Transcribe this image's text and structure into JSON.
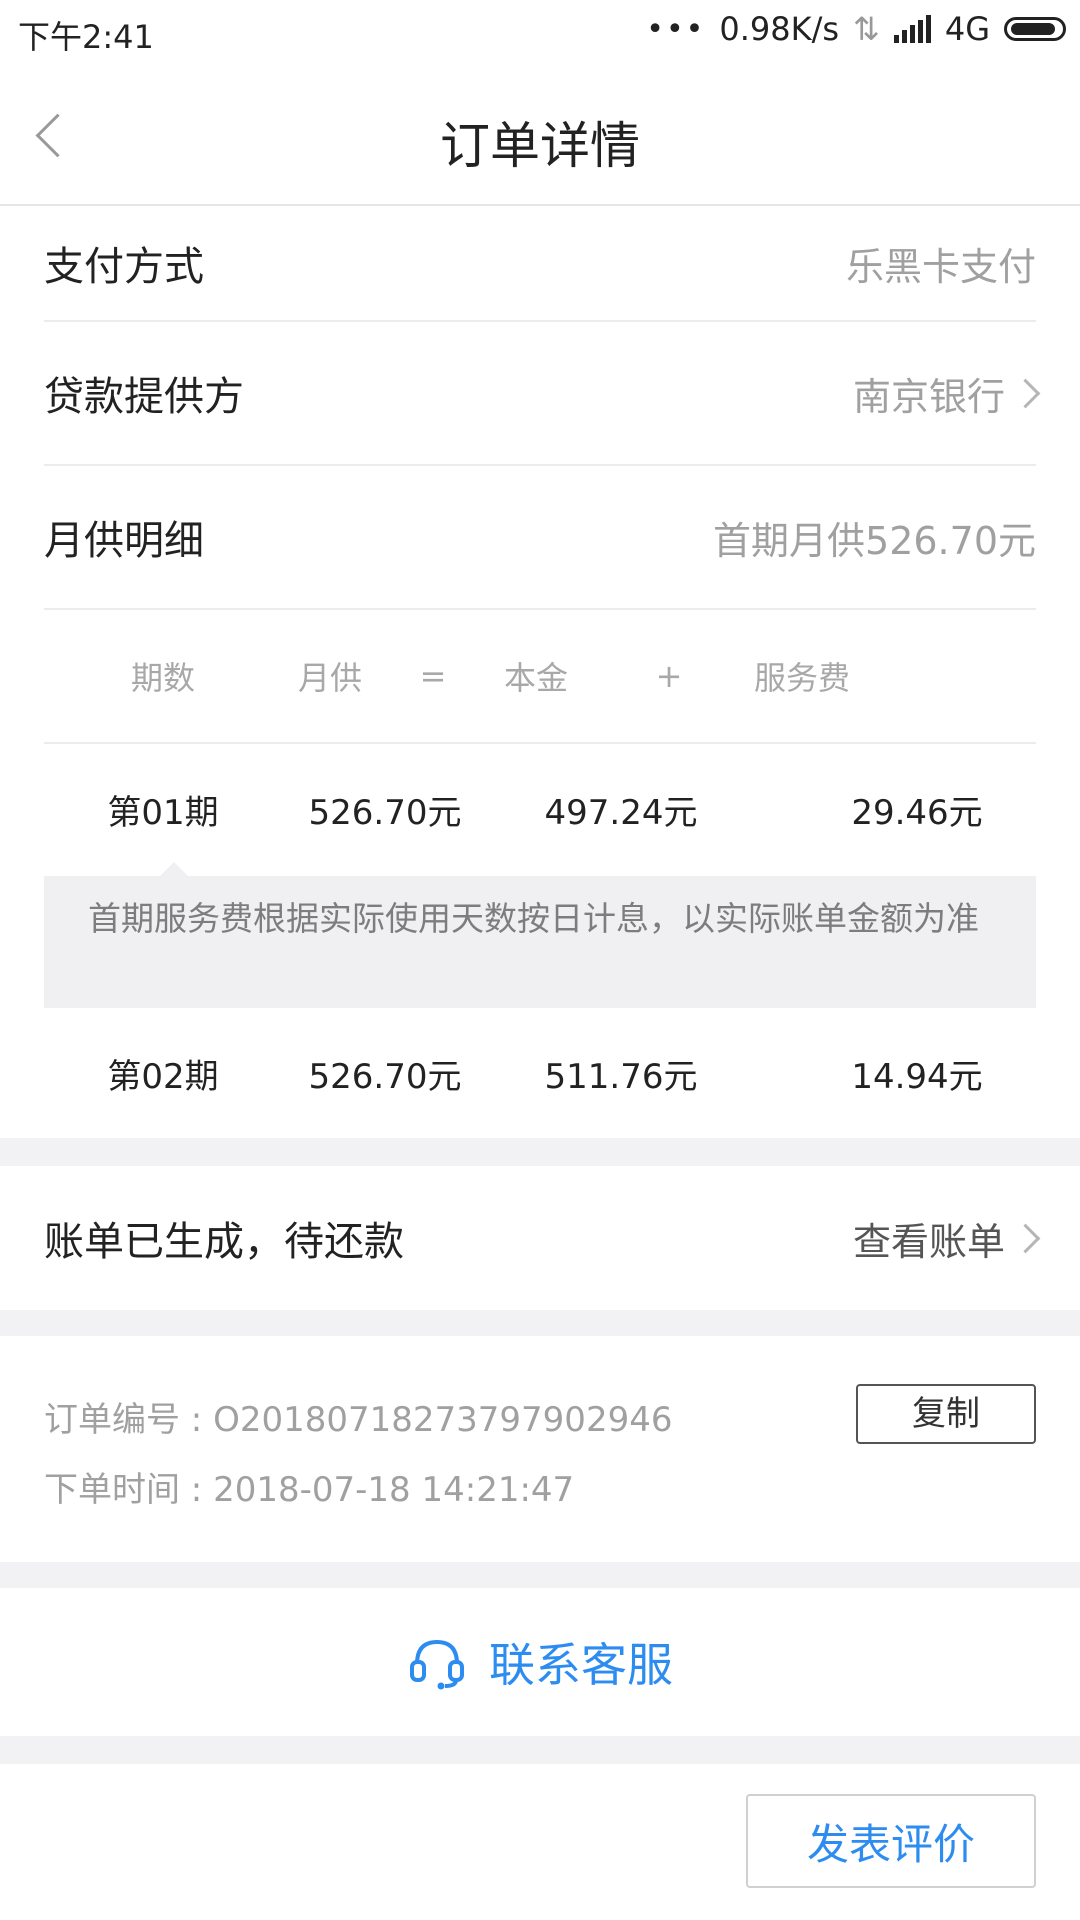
{
  "status_bar": {
    "time": "下午2:41",
    "speed": "0.98K/s",
    "network": "4G"
  },
  "header": {
    "title": "订单详情"
  },
  "payment": {
    "method_label": "支付方式",
    "method_value": "乐黑卡支付",
    "lender_label": "贷款提供方",
    "lender_value": "南京银行",
    "detail_label": "月供明细",
    "detail_value": "首期月供526.70元"
  },
  "table": {
    "headers": [
      "期数",
      "月供",
      "=",
      "本金",
      "+",
      "服务费"
    ],
    "rows": [
      {
        "period": "第01期",
        "monthly": "526.70元",
        "principal": "497.24元",
        "fee": "29.46元"
      },
      {
        "period": "第02期",
        "monthly": "526.70元",
        "principal": "511.76元",
        "fee": "14.94元"
      }
    ],
    "tip": "首期服务费根据实际使用天数按日计息，以实际账单金额为准"
  },
  "bill": {
    "status": "账单已生成，待还款",
    "link": "查看账单"
  },
  "order": {
    "number": "订单编号 : O20180718273797902946",
    "time": "下单时间 : 2018-07-18 14:21:47",
    "copy_label": "复制"
  },
  "service": {
    "label": "联系客服"
  },
  "footer": {
    "review_label": "发表评价"
  },
  "colors": {
    "accent": "#2c8cf0",
    "muted": "#a0a0a0"
  }
}
